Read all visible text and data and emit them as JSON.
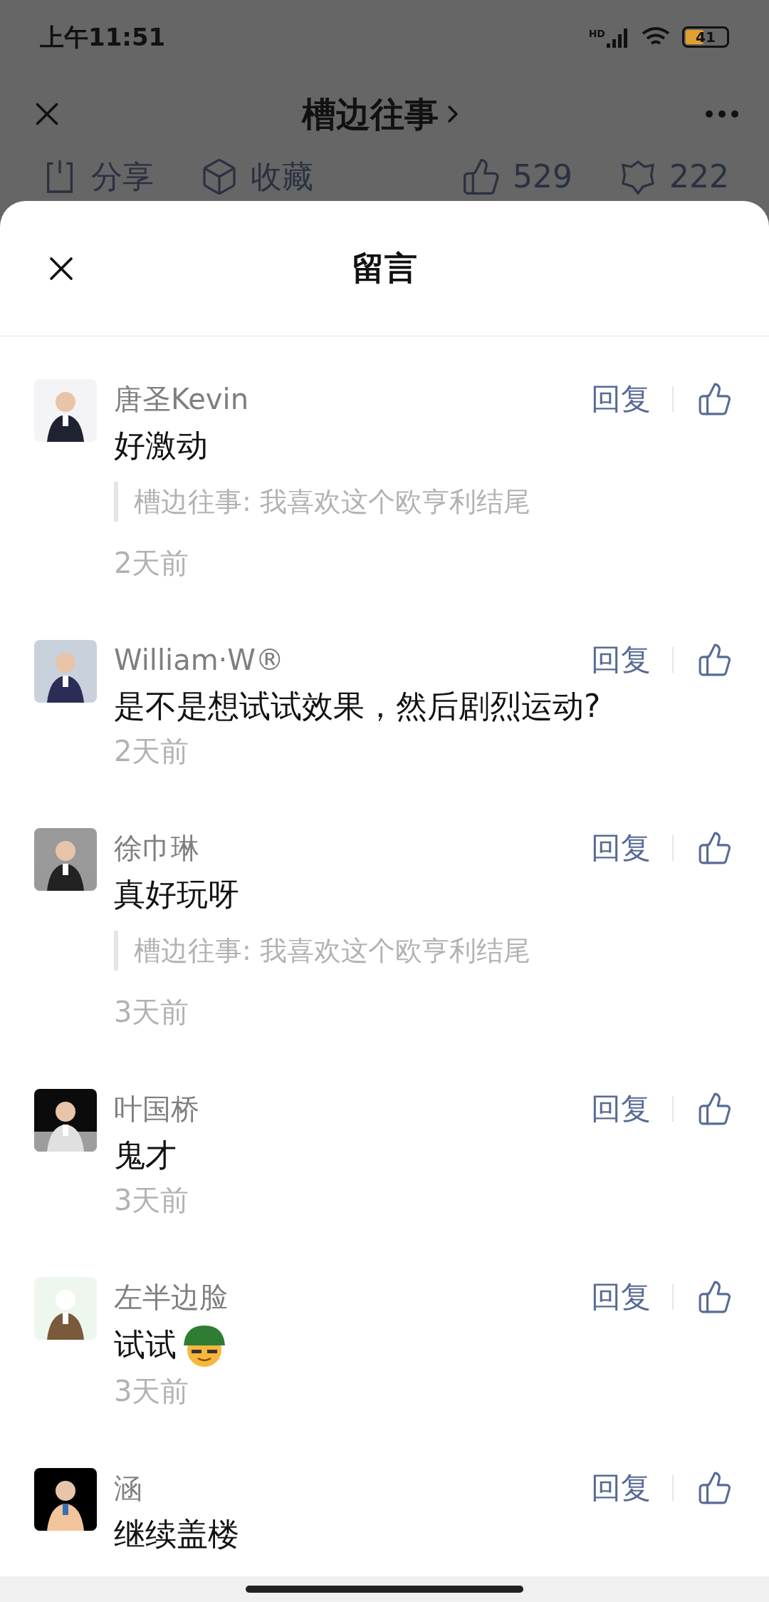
{
  "status_bar": {
    "time": "上午11:51",
    "network": "HD",
    "battery": "41"
  },
  "article_bar": {
    "title": "槽边往事",
    "actions": [
      {
        "label": "分享",
        "kind": "share"
      },
      {
        "label": "收藏",
        "kind": "collect"
      },
      {
        "label": "529",
        "kind": "like"
      },
      {
        "label": "222",
        "kind": "wow"
      }
    ]
  },
  "sheet": {
    "title": "留言"
  },
  "comments": [
    {
      "name": "唐圣Kevin",
      "text": "好激动",
      "has_emoji": false,
      "quote": "槽边往事: 我喜欢这个欧亨利结尾",
      "time": "2天前",
      "reply": "回复"
    },
    {
      "name": "William·W®",
      "text": "是不是想试试效果，然后剧烈运动?",
      "has_emoji": false,
      "time": "2天前",
      "reply": "回复"
    },
    {
      "name": "徐巾琳",
      "text": "真好玩呀",
      "has_emoji": false,
      "quote": "槽边往事: 我喜欢这个欧亨利结尾",
      "time": "3天前",
      "reply": "回复"
    },
    {
      "name": "叶国桥",
      "text": "鬼才",
      "has_emoji": false,
      "time": "3天前",
      "reply": "回复"
    },
    {
      "name": "左半边脸",
      "text": "试试",
      "has_emoji": true,
      "time": "3天前",
      "reply": "回复"
    },
    {
      "name": "涵",
      "text": "继续盖楼",
      "has_emoji": false,
      "reply": "回复"
    }
  ]
}
